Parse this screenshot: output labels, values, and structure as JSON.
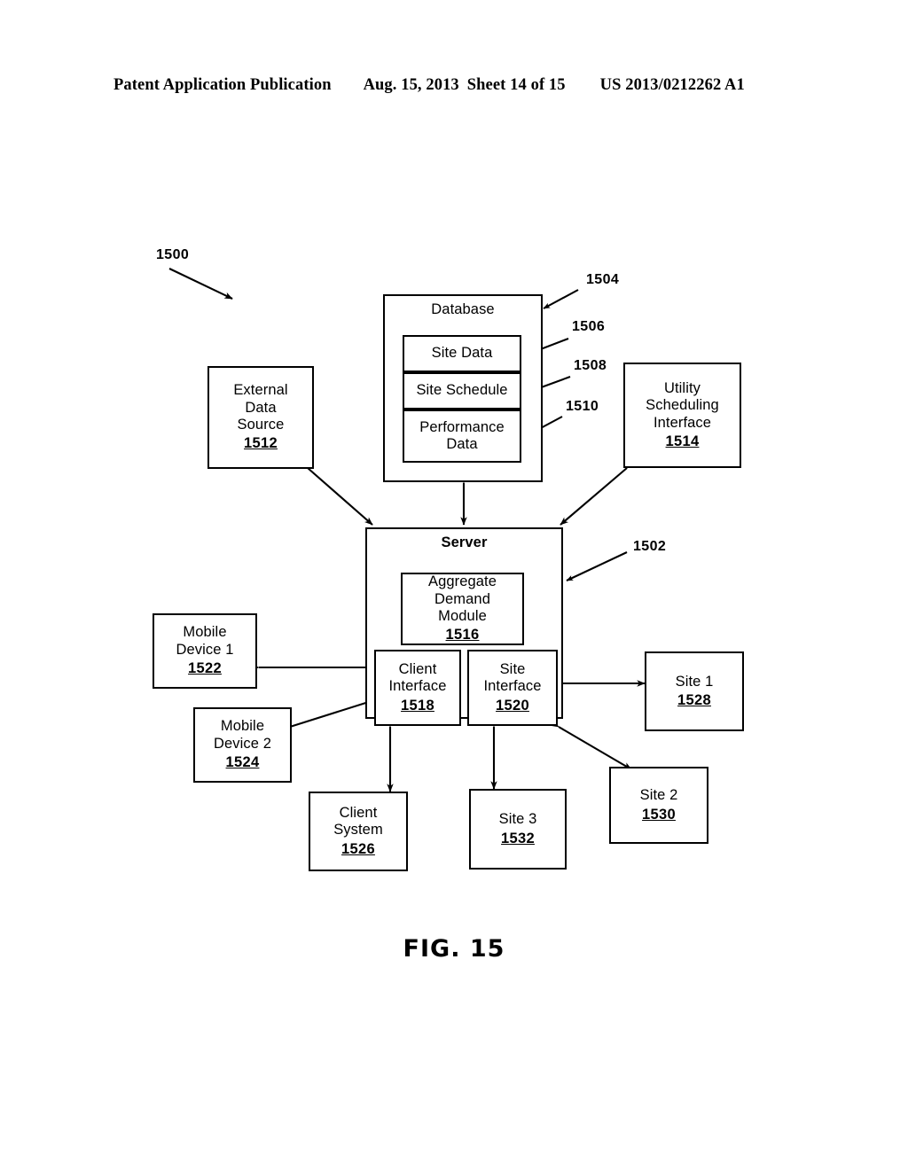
{
  "header": {
    "publication": "Patent Application Publication",
    "date": "Aug. 15, 2013",
    "sheet": "Sheet 14 of 15",
    "patent_number": "US 2013/0212262 A1"
  },
  "figure": {
    "caption": "FIG. 15",
    "system_ref": "1500"
  },
  "callouts": {
    "system": "1500",
    "server": "1502",
    "database": "1504",
    "site_data": "1506",
    "site_schedule": "1508",
    "performance_data": "1510"
  },
  "blocks": {
    "database": {
      "title": "Database",
      "children": [
        {
          "label": "Site Data",
          "ref": "1506"
        },
        {
          "label": "Site Schedule",
          "ref": "1508"
        },
        {
          "label": "Performance Data",
          "ref": "1510"
        }
      ]
    },
    "external_data_source": {
      "line1": "External",
      "line2": "Data",
      "line3": "Source",
      "ref": "1512"
    },
    "utility_scheduling_interface": {
      "line1": "Utility",
      "line2": "Scheduling",
      "line3": "Interface",
      "ref": "1514"
    },
    "server": {
      "title": "Server",
      "ref": "1502"
    },
    "aggregate_demand_module": {
      "line1": "Aggregate",
      "line2": "Demand",
      "line3": "Module",
      "ref": "1516"
    },
    "client_interface": {
      "line1": "Client",
      "line2": "Interface",
      "ref": "1518"
    },
    "site_interface": {
      "line1": "Site",
      "line2": "Interface",
      "ref": "1520"
    },
    "mobile_device_1": {
      "line1": "Mobile",
      "line2": "Device 1",
      "ref": "1522"
    },
    "mobile_device_2": {
      "line1": "Mobile",
      "line2": "Device 2",
      "ref": "1524"
    },
    "client_system": {
      "line1": "Client",
      "line2": "System",
      "ref": "1526"
    },
    "site_1": {
      "line1": "Site 1",
      "ref": "1528"
    },
    "site_2": {
      "line1": "Site 2",
      "ref": "1530"
    },
    "site_3": {
      "line1": "Site 3",
      "ref": "1532"
    }
  },
  "colors": {
    "ink": "#000000",
    "paper": "#ffffff"
  }
}
